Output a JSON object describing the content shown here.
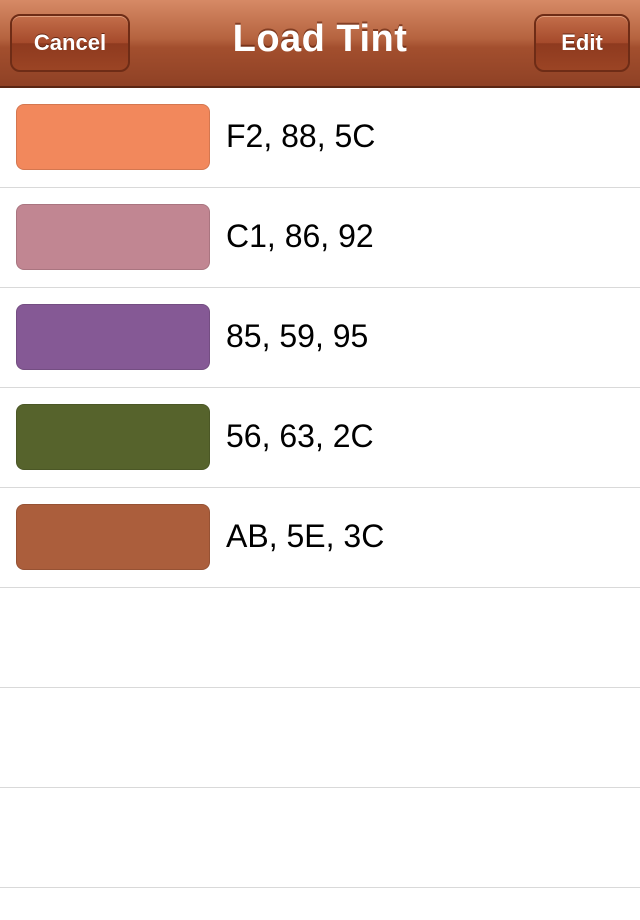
{
  "navbar": {
    "title": "Load Tint",
    "cancel_label": "Cancel",
    "edit_label": "Edit"
  },
  "tints": [
    {
      "label": "F2, 88, 5C",
      "color": "#F2885C"
    },
    {
      "label": "C1, 86, 92",
      "color": "#C18692"
    },
    {
      "label": "85, 59, 95",
      "color": "#855995"
    },
    {
      "label": "56, 63, 2C",
      "color": "#56632C"
    },
    {
      "label": "AB, 5E, 3C",
      "color": "#AB5E3C"
    }
  ],
  "empty_rows": 3,
  "colors": {
    "navbar_accent": "#A54A2B",
    "separator": "#D9D9D9"
  }
}
